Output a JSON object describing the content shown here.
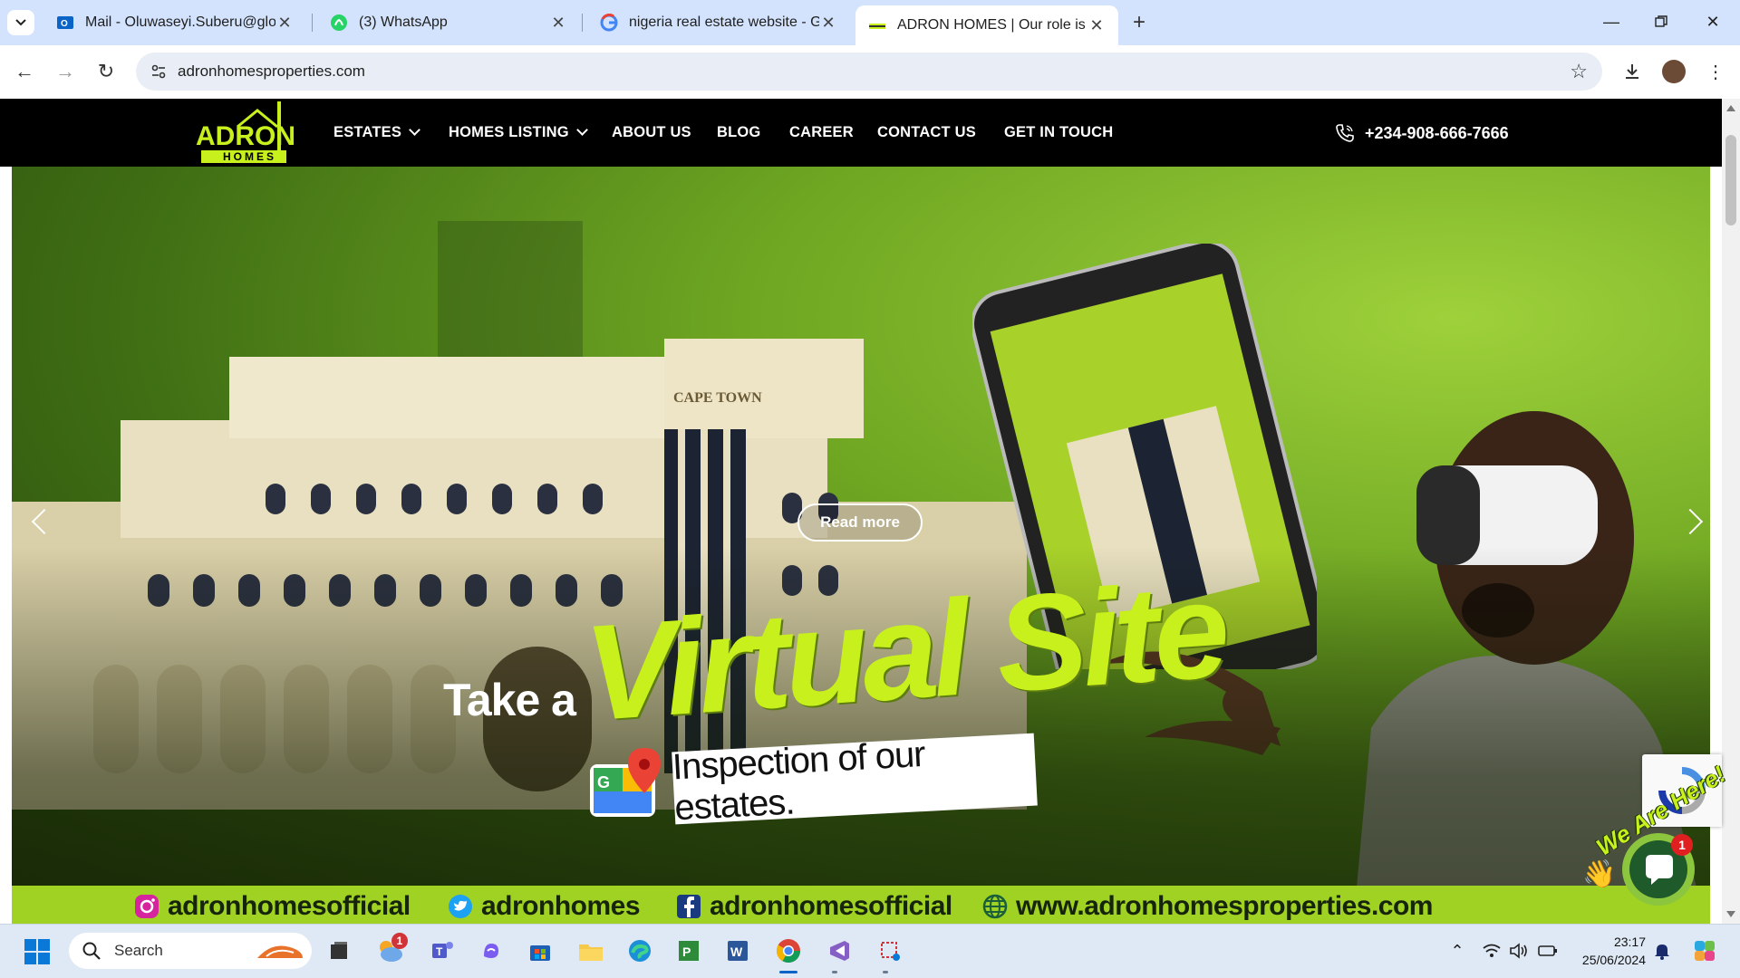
{
  "browser": {
    "tabs": [
      {
        "title": "Mail - Oluwaseyi.Suberu@glow",
        "icon": "outlook-icon",
        "active": false
      },
      {
        "title": "(3) WhatsApp",
        "icon": "whatsapp-icon",
        "active": false
      },
      {
        "title": "nigeria real estate website - Go",
        "icon": "google-icon",
        "active": false
      },
      {
        "title": "ADRON HOMES | Our role is to",
        "icon": "adron-favicon",
        "active": true
      }
    ],
    "url": "adronhomesproperties.com"
  },
  "site": {
    "logo_text_top": "ADRON",
    "logo_text_bottom": "HOMES",
    "nav": [
      {
        "label": "ESTATES",
        "dropdown": true
      },
      {
        "label": "HOMES LISTING",
        "dropdown": true
      },
      {
        "label": "ABOUT US",
        "dropdown": false
      },
      {
        "label": "BLOG",
        "dropdown": false
      },
      {
        "label": "CAREER",
        "dropdown": false
      },
      {
        "label": "CONTACT US",
        "dropdown": false
      },
      {
        "label": "GET IN TOUCH",
        "dropdown": false
      }
    ],
    "phone": "+234-908-666-7666",
    "hero": {
      "building_sign": "CAPE TOWN",
      "read_more": "Read more",
      "headline_small": "Take a",
      "headline_big": "Virtual Site",
      "subheadline": "Inspection of our estates.",
      "social": [
        {
          "icon": "instagram-icon",
          "text": "adronhomesofficial"
        },
        {
          "icon": "twitter-icon",
          "text": "adronhomes"
        },
        {
          "icon": "facebook-icon",
          "text": "adronhomesofficial"
        },
        {
          "icon": "globe-icon",
          "text": "www.adronhomesproperties.com"
        }
      ]
    },
    "chat": {
      "tagline": "We Are Here!",
      "badge": "1"
    }
  },
  "taskbar": {
    "search_label": "Search",
    "weather_badge": "1",
    "time": "23:17",
    "date": "25/06/2024"
  },
  "colors": {
    "accent_green": "#c8f01c",
    "nav_bg": "#000000",
    "tab_strip": "#d3e3fd"
  }
}
